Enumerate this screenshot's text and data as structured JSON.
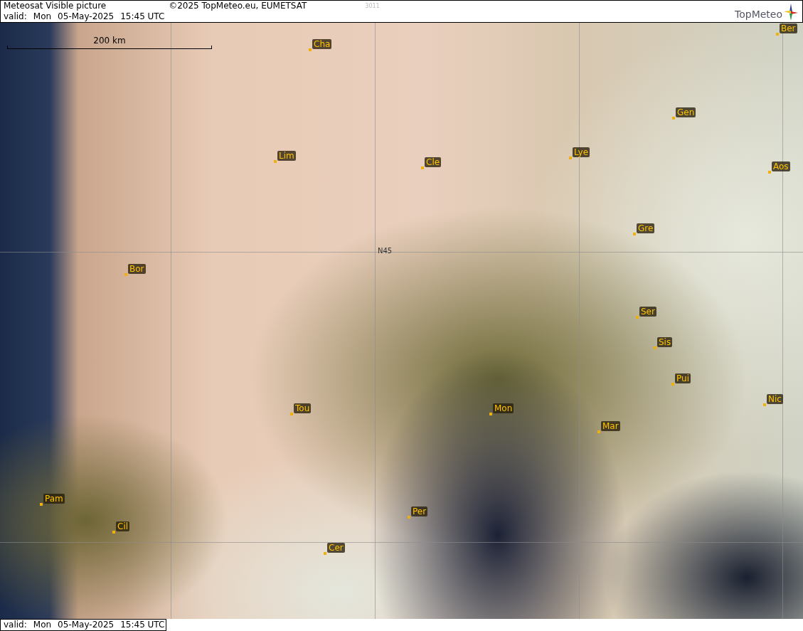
{
  "header": {
    "title": "Meteosat Visible picture",
    "copyright": "©2025 TopMeteo.eu, EUMETSAT",
    "code": "3011",
    "valid": {
      "label": "valid:",
      "day": "Mon",
      "date": "05-May-2025",
      "time": "15:45 UTC"
    },
    "logo": "TopMeteo"
  },
  "map": {
    "scale": "200 km",
    "latitude_label": "N45",
    "places": [
      {
        "label": "Cha"
      },
      {
        "label": "Ber"
      },
      {
        "label": "Gen"
      },
      {
        "label": "Lim"
      },
      {
        "label": "Cle"
      },
      {
        "label": "Lye"
      },
      {
        "label": "Aos"
      },
      {
        "label": "Gre"
      },
      {
        "label": "Bor"
      },
      {
        "label": "Ser"
      },
      {
        "label": "Sis"
      },
      {
        "label": "Pui"
      },
      {
        "label": "Tou"
      },
      {
        "label": "Mon"
      },
      {
        "label": "Nic"
      },
      {
        "label": "Mar"
      },
      {
        "label": "Pam"
      },
      {
        "label": "Cil"
      },
      {
        "label": "Per"
      },
      {
        "label": "Cer"
      }
    ]
  },
  "footer": {
    "valid": {
      "label": "valid:",
      "day": "Mon",
      "date": "05-May-2025",
      "time": "15:45 UTC"
    }
  }
}
